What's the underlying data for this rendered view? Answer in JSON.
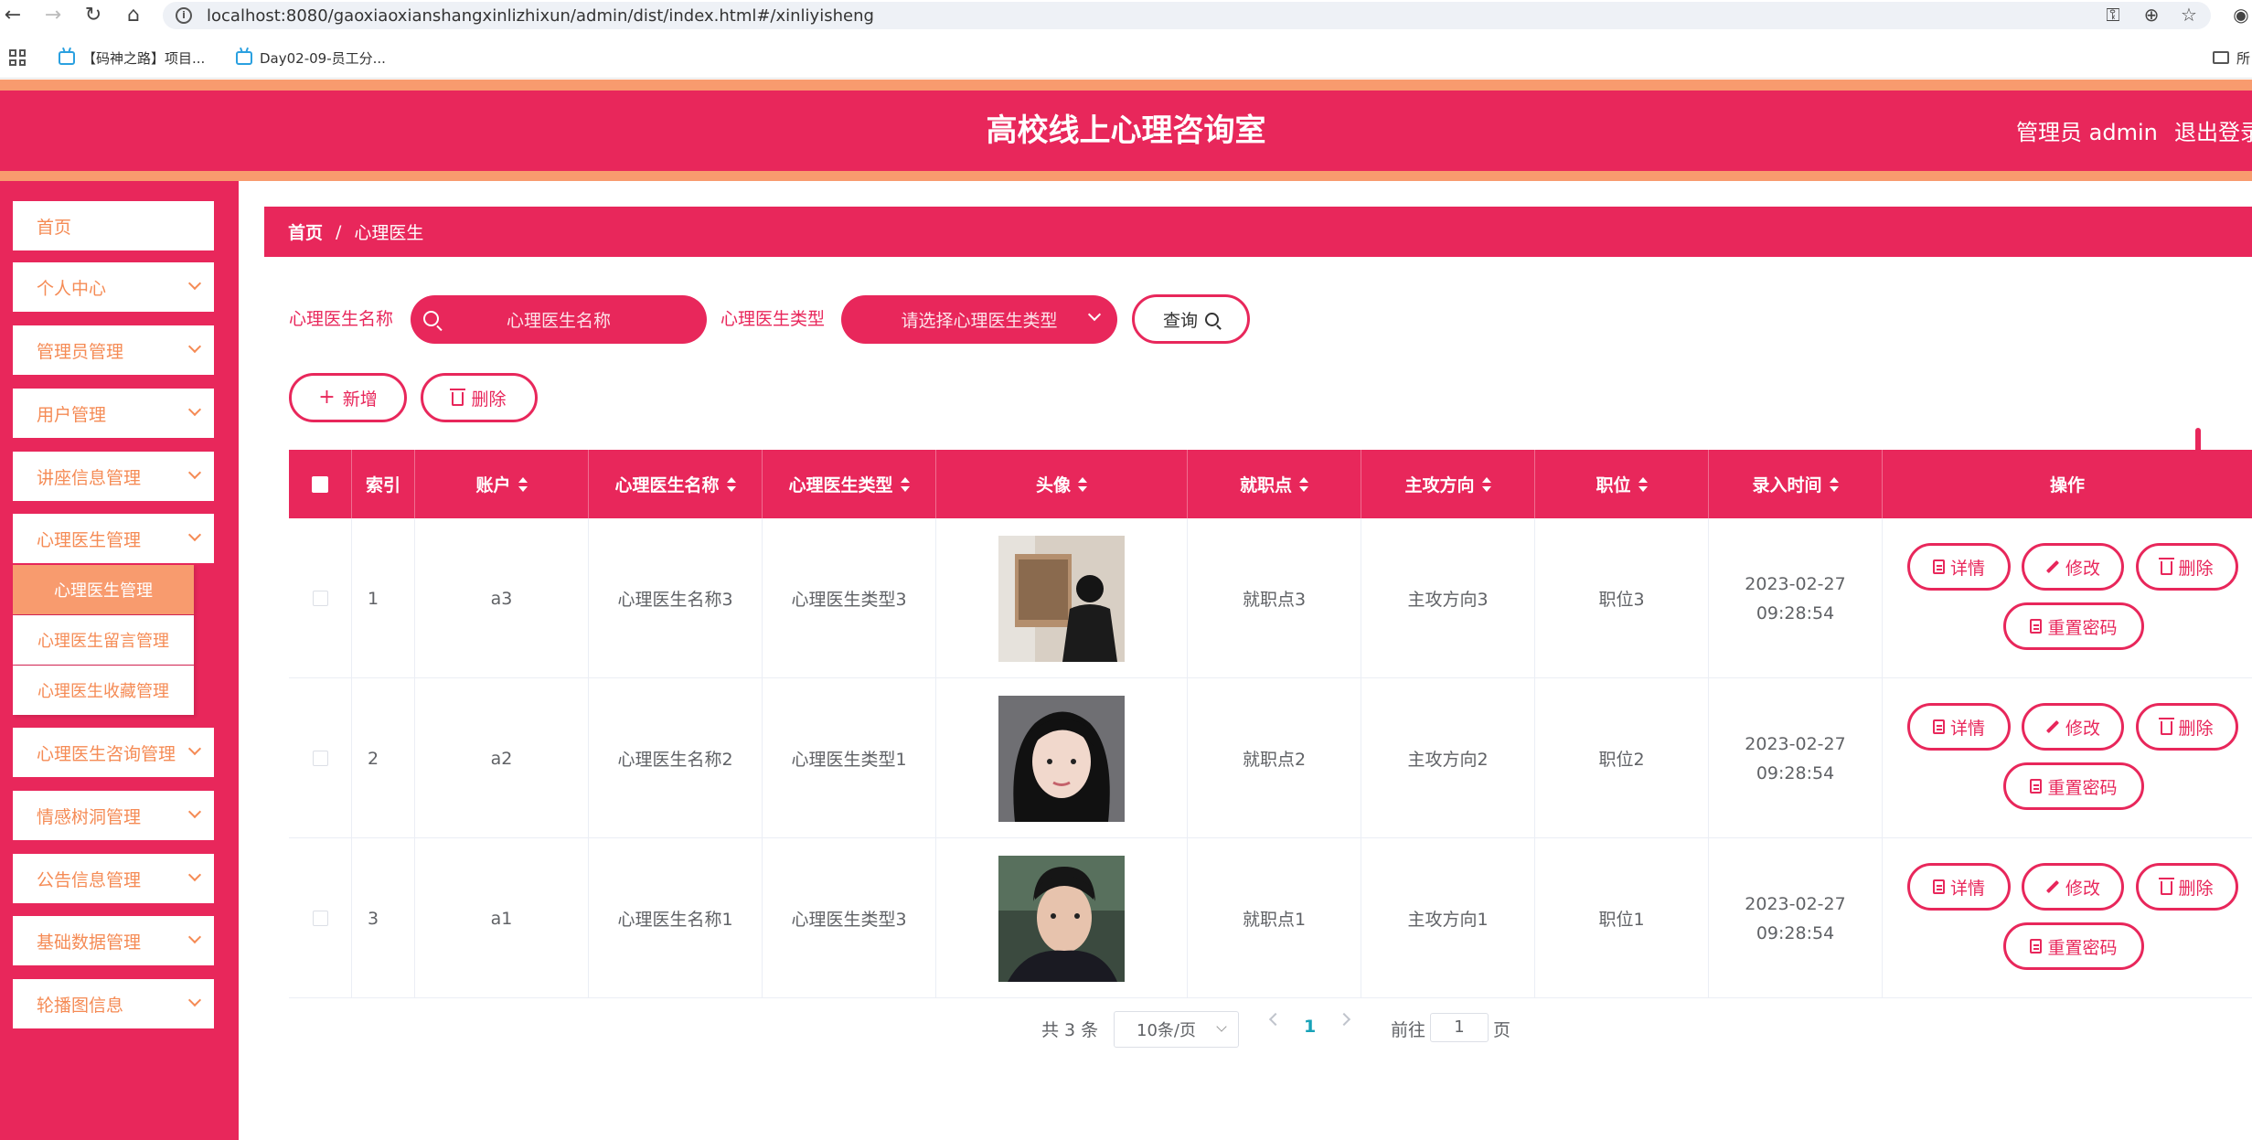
{
  "browser": {
    "url": "localhost:8080/gaoxiaoxianshangxinlizhixun/admin/dist/index.html#/xinliyisheng",
    "bookmarks": [
      "【码神之路】项目...",
      "Day02-09-员工分..."
    ],
    "bookmarks_right": "所"
  },
  "header": {
    "title": "高校线上心理咨询室",
    "admin_label": "管理员 admin",
    "logout_label": "退出登录"
  },
  "sidebar": {
    "items": [
      {
        "label": "首页"
      },
      {
        "label": "个人中心"
      },
      {
        "label": "管理员管理"
      },
      {
        "label": "用户管理"
      },
      {
        "label": "讲座信息管理"
      },
      {
        "label": "心理医生管理"
      },
      {
        "label": "心理医生咨询管理"
      },
      {
        "label": "情感树洞管理"
      },
      {
        "label": "公告信息管理"
      },
      {
        "label": "基础数据管理"
      },
      {
        "label": "轮播图信息"
      }
    ],
    "submenu": [
      {
        "label": "心理医生管理"
      },
      {
        "label": "心理医生留言管理"
      },
      {
        "label": "心理医生收藏管理"
      }
    ]
  },
  "breadcrumb": {
    "home": "首页",
    "separator": "/",
    "current": "心理医生"
  },
  "search": {
    "name_label": "心理医生名称",
    "name_placeholder": "心理医生名称",
    "type_label": "心理医生类型",
    "type_placeholder": "请选择心理医生类型",
    "query_label": "查询"
  },
  "toolbar": {
    "add_label": "新增",
    "delete_label": "删除"
  },
  "table": {
    "headers": [
      "索引",
      "账户",
      "心理医生名称",
      "心理医生类型",
      "头像",
      "就职点",
      "主攻方向",
      "职位",
      "录入时间",
      "操作"
    ],
    "rows": [
      {
        "index": "1",
        "account": "a3",
        "name": "心理医生名称3",
        "type": "心理医生类型3",
        "location": "就职点3",
        "direction": "主攻方向3",
        "position": "职位3",
        "time": "2023-02-27 09:28:54"
      },
      {
        "index": "2",
        "account": "a2",
        "name": "心理医生名称2",
        "type": "心理医生类型1",
        "location": "就职点2",
        "direction": "主攻方向2",
        "position": "职位2",
        "time": "2023-02-27 09:28:54"
      },
      {
        "index": "3",
        "account": "a1",
        "name": "心理医生名称1",
        "type": "心理医生类型3",
        "location": "就职点1",
        "direction": "主攻方向1",
        "position": "职位1",
        "time": "2023-02-27 09:28:54"
      }
    ],
    "actions": {
      "detail": "详情",
      "edit": "修改",
      "delete": "删除",
      "reset": "重置密码"
    }
  },
  "pagination": {
    "total": "共 3 条",
    "page_size": "10条/页",
    "current_page": "1",
    "goto_prefix": "前往",
    "goto_value": "1",
    "goto_suffix": "页"
  },
  "colors": {
    "primary": "#e8275b",
    "accent": "#f89b6e",
    "menu_text": "#f58b55"
  }
}
